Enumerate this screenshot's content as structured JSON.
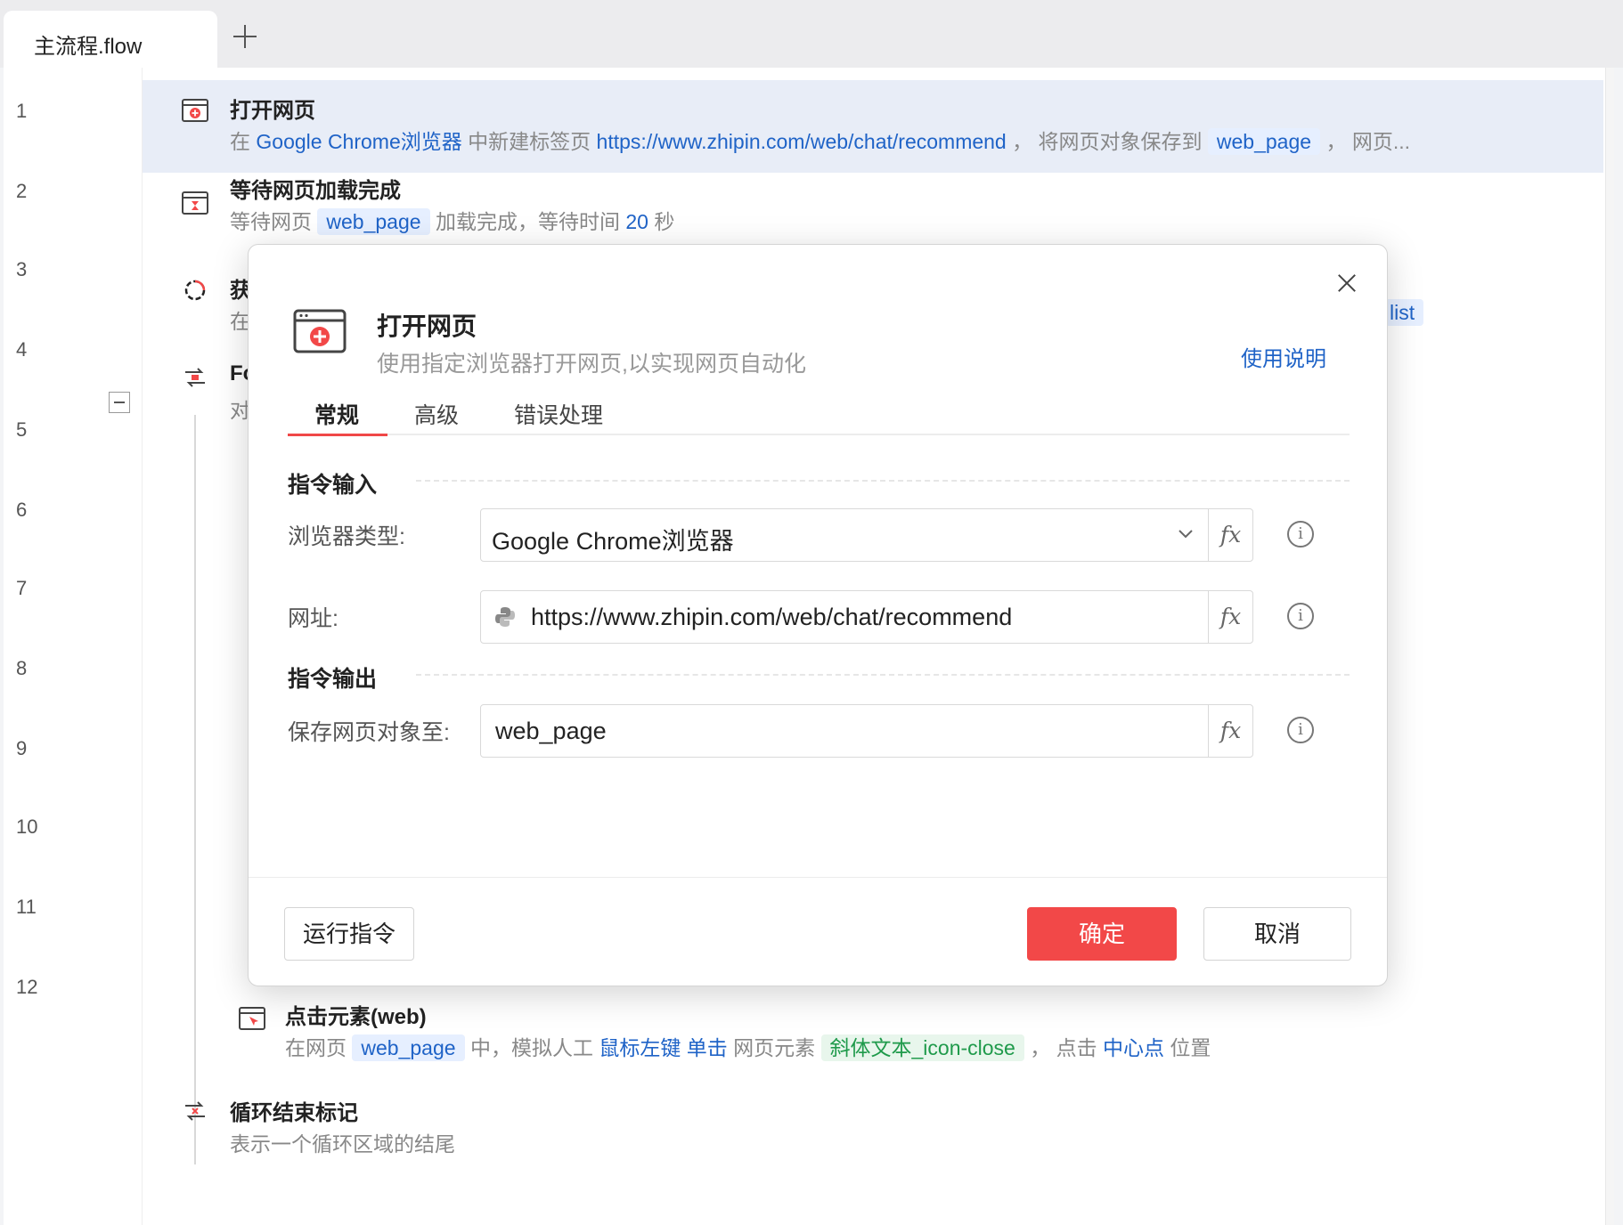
{
  "tabbar": {
    "active_tab": "主流程.flow",
    "add_tab_icon": "plus-icon"
  },
  "line_numbers": [
    "1",
    "2",
    "3",
    "4",
    "5",
    "6",
    "7",
    "8",
    "9",
    "10",
    "11",
    "12"
  ],
  "rows": {
    "r1": {
      "title": "打开网页",
      "d_prefix": "在",
      "d_browser": "Google Chrome浏览器",
      "d_mid": "中新建标签页",
      "d_url": "https://www.zhipin.com/web/chat/recommend",
      "d_mid2": "，  将网页对象保存到",
      "d_var": "web_page",
      "d_tail": "，  网页..."
    },
    "r2": {
      "title": "等待网页加载完成",
      "d_prefix": "等待网页",
      "d_var": "web_page",
      "d_mid": "加载完成，等待时间",
      "d_num": "20",
      "d_unit": "秒"
    },
    "r3": {
      "title_partial": "获",
      "desc_partial": "在",
      "var_partial": "list"
    },
    "r4": {
      "title_partial": "Fo",
      "desc_partial": "对"
    },
    "r11": {
      "title": "点击元素(web)",
      "d_prefix": "在网页",
      "d_var": "web_page",
      "d_mid": "中，模拟人工",
      "d_btn": "鼠标左键",
      "d_click": "单击",
      "d_mid2": "网页元素",
      "d_elem": "斜体文本_icon-close",
      "d_mid3": "，  点击",
      "d_pos": "中心点",
      "d_tail": "位置"
    },
    "r12": {
      "title": "循环结束标记",
      "desc": "表示一个循环区域的结尾"
    }
  },
  "modal": {
    "title": "打开网页",
    "subtitle": "使用指定浏览器打开网页,以实现网页自动化",
    "help_link": "使用说明",
    "tabs": [
      "常规",
      "高级",
      "错误处理"
    ],
    "section_input": "指令输入",
    "section_output": "指令输出",
    "fields": {
      "browser_label": "浏览器类型:",
      "browser_value": "Google Chrome浏览器",
      "url_label": "网址:",
      "url_value": "https://www.zhipin.com/web/chat/recommend",
      "save_label": "保存网页对象至:",
      "save_value": "web_page",
      "fx_label": "fx",
      "info_glyph": "i"
    },
    "buttons": {
      "run": "运行指令",
      "ok": "确定",
      "cancel": "取消"
    }
  },
  "colors": {
    "accent_red": "#f24848",
    "link_blue": "#1f63c7",
    "var_bg": "#e6efff",
    "green_text": "#1f9a4b",
    "selected_row": "#e8edf7"
  }
}
